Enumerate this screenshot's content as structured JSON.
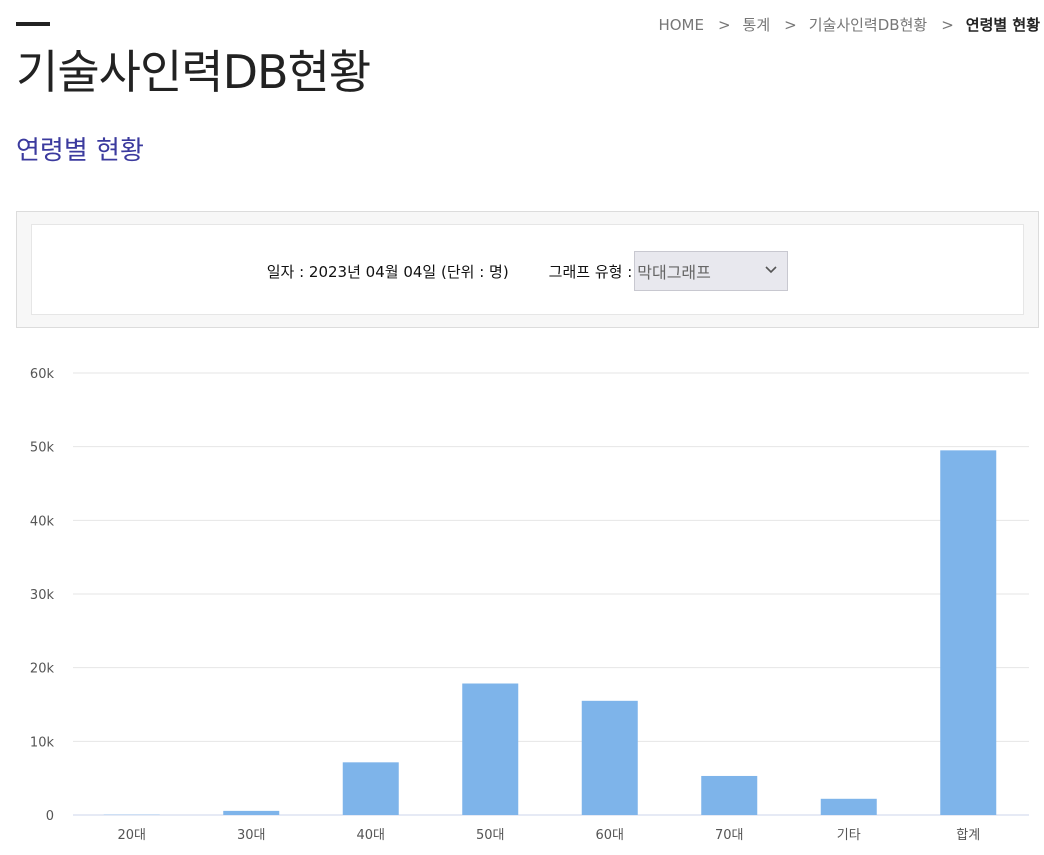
{
  "header": {
    "title": "기술사인력DB현황",
    "breadcrumb": [
      "HOME",
      "통계",
      "기술사인력DB현황",
      "연령별 현황"
    ],
    "breadcrumb_separator": ">"
  },
  "section": {
    "title": "연령별 현황"
  },
  "filter": {
    "date_text": "일자 : 2023년 04월 04일 (단위 : 명)",
    "graph_type_label": "그래프 유형 :",
    "graph_type_value": "막대그래프"
  },
  "colors": {
    "bar": "#7eb4ea",
    "section_title": "#3b3a9e",
    "grid": "#e6e6e6"
  },
  "chart_data": {
    "type": "bar",
    "categories": [
      "20대",
      "30대",
      "40대",
      "50대",
      "60대",
      "70대",
      "기타",
      "합계"
    ],
    "values": [
      40,
      560,
      7150,
      17850,
      15500,
      5300,
      2200,
      49500
    ],
    "ylim": [
      0,
      60000
    ],
    "yticks": [
      0,
      10000,
      20000,
      30000,
      40000,
      50000,
      60000
    ],
    "ytick_labels": [
      "0",
      "10k",
      "20k",
      "30k",
      "40k",
      "50k",
      "60k"
    ],
    "title": "",
    "xlabel": "",
    "ylabel": "",
    "grid": true
  }
}
